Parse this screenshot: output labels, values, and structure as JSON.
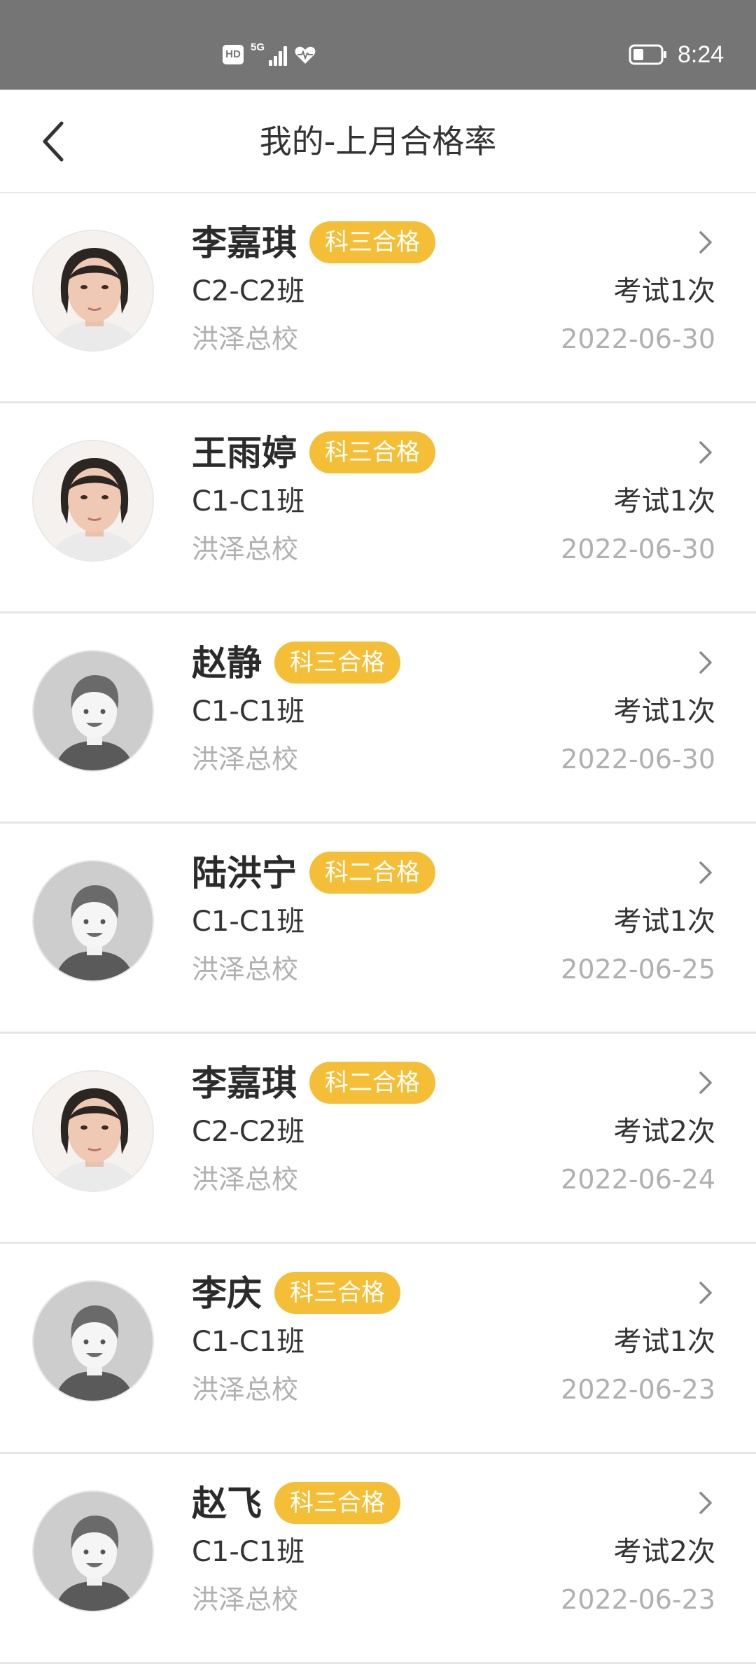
{
  "status_bar": {
    "hd": "HD",
    "network": "5G",
    "time": "8:24",
    "icons": [
      "hd-icon",
      "signal-icon",
      "health-heart-icon",
      "battery-icon"
    ]
  },
  "header": {
    "title": "我的-上月合格率",
    "back_icon": "chevron-left-icon"
  },
  "colors": {
    "accent": "#f4bf37",
    "status_bar_bg": "#757575",
    "muted_text": "#b0b0b0",
    "divider": "#e6e6e6"
  },
  "records": [
    {
      "name": "李嘉琪",
      "badge": "科三合格",
      "class": "C2-C2班",
      "exams": "考试1次",
      "school": "洪泽总校",
      "date": "2022-06-30",
      "avatar": "photo-female"
    },
    {
      "name": "王雨婷",
      "badge": "科三合格",
      "class": "C1-C1班",
      "exams": "考试1次",
      "school": "洪泽总校",
      "date": "2022-06-30",
      "avatar": "photo-female"
    },
    {
      "name": "赵静",
      "badge": "科三合格",
      "class": "C1-C1班",
      "exams": "考试1次",
      "school": "洪泽总校",
      "date": "2022-06-30",
      "avatar": "default-avatar"
    },
    {
      "name": "陆洪宁",
      "badge": "科二合格",
      "class": "C1-C1班",
      "exams": "考试1次",
      "school": "洪泽总校",
      "date": "2022-06-25",
      "avatar": "default-avatar"
    },
    {
      "name": "李嘉琪",
      "badge": "科二合格",
      "class": "C2-C2班",
      "exams": "考试2次",
      "school": "洪泽总校",
      "date": "2022-06-24",
      "avatar": "photo-female"
    },
    {
      "name": "李庆",
      "badge": "科三合格",
      "class": "C1-C1班",
      "exams": "考试1次",
      "school": "洪泽总校",
      "date": "2022-06-23",
      "avatar": "default-avatar"
    },
    {
      "name": "赵飞",
      "badge": "科三合格",
      "class": "C1-C1班",
      "exams": "考试2次",
      "school": "洪泽总校",
      "date": "2022-06-23",
      "avatar": "default-avatar"
    }
  ]
}
